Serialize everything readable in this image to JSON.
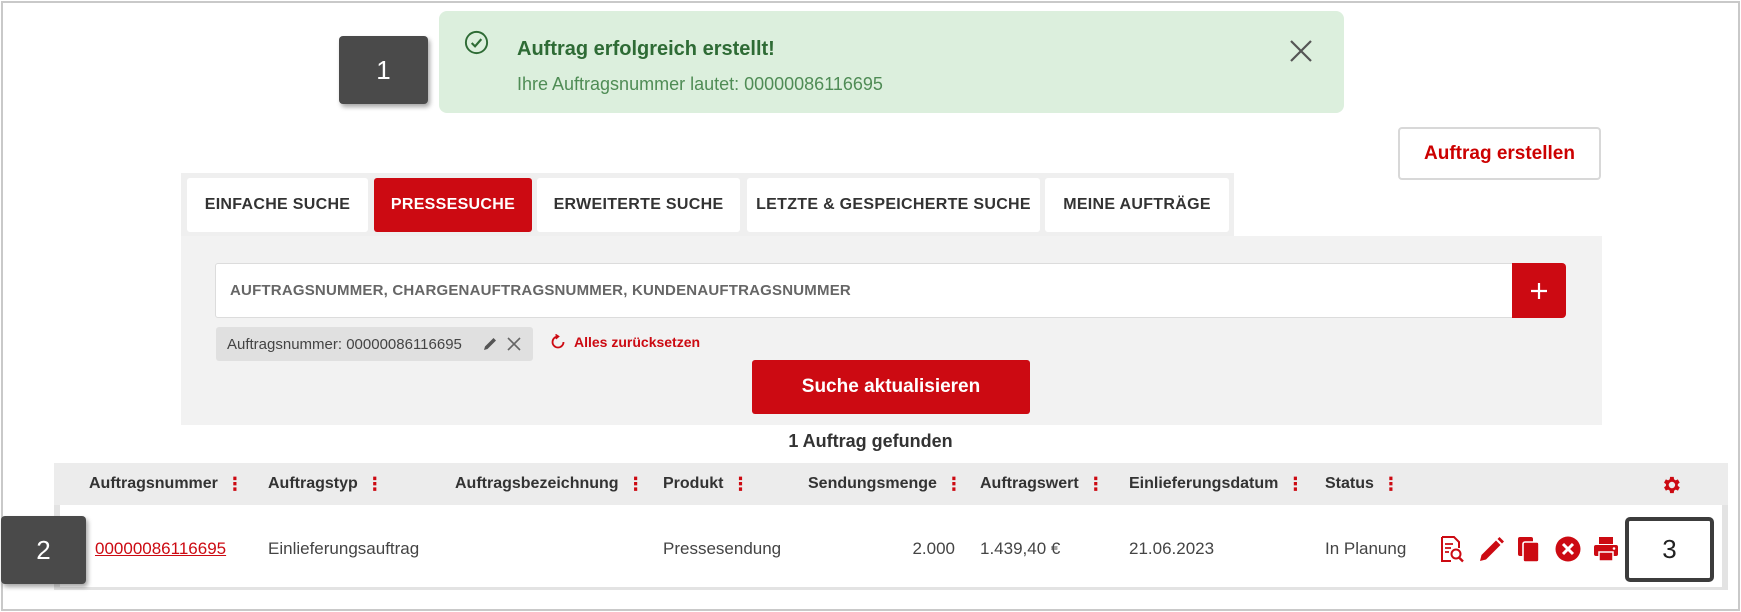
{
  "alert": {
    "title": "Auftrag erfolgreich erstellt!",
    "message": "Ihre Auftragsnummer lautet: 00000086116695",
    "icon": "check-circle-icon",
    "color": "#2e6b35",
    "background": "#dcefdd"
  },
  "callouts": {
    "one": "1",
    "two": "2",
    "three": "3"
  },
  "toolbar": {
    "create_label": "Auftrag erstellen"
  },
  "tabs": [
    {
      "label": "EINFACHE SUCHE",
      "active": false
    },
    {
      "label": "PRESSESUCHE",
      "active": true
    },
    {
      "label": "ERWEITERTE SUCHE",
      "active": false
    },
    {
      "label": "LETZTE & GESPEICHERTE SUCHE",
      "active": false
    },
    {
      "label": "MEINE AUFTRÄGE",
      "active": false
    }
  ],
  "search": {
    "placeholder": "AUFTRAGSNUMMER, CHARGENAUFTRAGSNUMMER, KUNDENAUFTRAGSNUMMER",
    "add_icon": "plus-icon",
    "filter_chip": "Auftragsnummer: 00000086116695",
    "reset_label": "Alles zurücksetzen",
    "update_label": "Suche aktualisieren"
  },
  "results": {
    "count_text": "1 Auftrag gefunden"
  },
  "table": {
    "columns": [
      "Auftragsnummer",
      "Auftragstyp",
      "Auftragsbezeichnung",
      "Produkt",
      "Sendungsmenge",
      "Auftragswert",
      "Einlieferungsdatum",
      "Status"
    ],
    "rows": [
      {
        "auftragsnummer": "00000086116695",
        "auftragstyp": "Einlieferungsauftrag",
        "auftragsbezeichnung": "",
        "produkt": "Pressesendung",
        "sendungsmenge": "2.000",
        "auftragswert": "1.439,40 €",
        "einlieferungsdatum": "21.06.2023",
        "status": "In Planung"
      }
    ],
    "row_actions": [
      "document-search-icon",
      "pencil-icon",
      "copy-icon",
      "cancel-circle-icon",
      "print-icon"
    ],
    "settings_icon": "gear-icon"
  },
  "colors": {
    "accent": "#cc0a12",
    "success_text": "#2e6b35"
  }
}
